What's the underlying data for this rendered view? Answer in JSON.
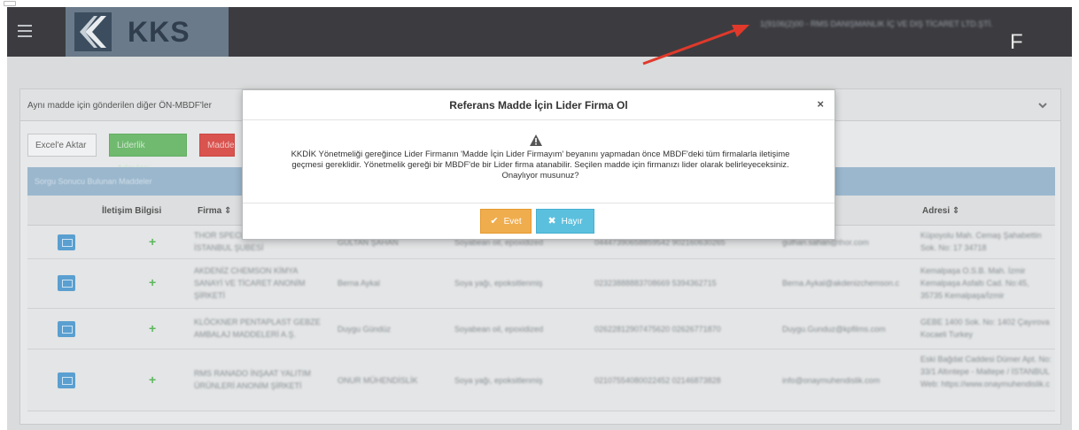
{
  "app": {
    "logo_text": "KKS",
    "user_info_line": "1(9106(2)00 - RMS DANIŞMANLIK İÇ VE DIŞ TİCARET LTD.ŞTİ.",
    "avatar_letter": "F"
  },
  "panel": {
    "title": "Aynı madde için gönderilen diğer ÖN-MBDF'ler"
  },
  "toolbar": {
    "excel_label": "Excel'e Aktar",
    "leader_candidates_label": "Liderlik Adayları",
    "red_button_label": "Madde"
  },
  "table": {
    "caption": "Sorgu Sonucu Bulunan Maddeler",
    "headers": {
      "contact": "İletişim Bilgisi",
      "firm": "Firma ⇕",
      "address": "Adresi ⇕"
    },
    "rows": [
      {
        "firm": "THOR SPECIALTIES ... TÜRKİYE İSTANBUL ŞUBESİ",
        "person": "GÜLTAN ŞAHAN",
        "substance": "Soyabean oil, epoxidized",
        "phone": "04447390658859542 902160630265",
        "email": "gulhan.sahan@thor.com",
        "address": "Küpoyolu Mah. Cemaş Şahabettin Sok. No: 17 34718"
      },
      {
        "firm": "AKDENİZ CHEMSON KİMYA SANAYİ VE TİCARET ANONİM ŞİRKETİ",
        "person": "Berna Aykal",
        "substance": "Soya yağı, epoksitlenmiş",
        "phone": "02323888883708669 5394362715",
        "email": "Berna.Aykal@akdenizchemson.c",
        "address": "Kemalpaşa O.S.B. Mah. İzmir Kemalpaşa Asfaltı Cad. No:45, 35735 Kemalpaşa/İzmir"
      },
      {
        "firm": "KLÖCKNER PENTAPLAST GEBZE AMBALAJ MADDELERİ A.Ş.",
        "person": "Duygu Gündüz",
        "substance": "Soyabean oil, epoxidized",
        "phone": "02622812907475620 02626771870",
        "email": "Duygu.Gunduz@kpfilms.com",
        "address": "GEBE 1400 Sok. No: 1402 Çayırova Kocaeli Turkey"
      },
      {
        "firm": "RMS RANADO İNŞAAT YALITIM ÜRÜNLERİ ANONİM ŞİRKETİ",
        "person": "ONUR MÜHENDİSLİK",
        "substance": "Soya yağı, epoksitlenmiş",
        "phone": "02107554080022452 02146873828",
        "email": "info@onaymuhendislik.com",
        "address": "Eski Bağdat Caddesi Dümer Apt. No: 33/1 Altıntepe - Maltepe / İSTANBUL Web: https://www.onaymuhendislik.c"
      }
    ]
  },
  "modal": {
    "title": "Referans Madde İçin Lider Firma Ol",
    "close": "×",
    "body": "KKDİK Yönetmeliği gereğince Lider Firmanın 'Madde İçin Lider Firmayım' beyanını yapmadan önce MBDF'deki tüm firmalarla iletişime geçmesi gereklidir. Yönetmelik gereği bir MBDF'de bir Lider firma atanabilir. Seçilen madde için firmanızı lider olarak belirleyeceksiniz. Onaylıyor musunuz?",
    "confirm_label": "Evet",
    "cancel_label": "Hayır"
  },
  "colors": {
    "navbar": "#3c3c40",
    "confirm": "#f0ad4e",
    "cancel": "#5bc0de",
    "arrow": "#e0392b"
  }
}
